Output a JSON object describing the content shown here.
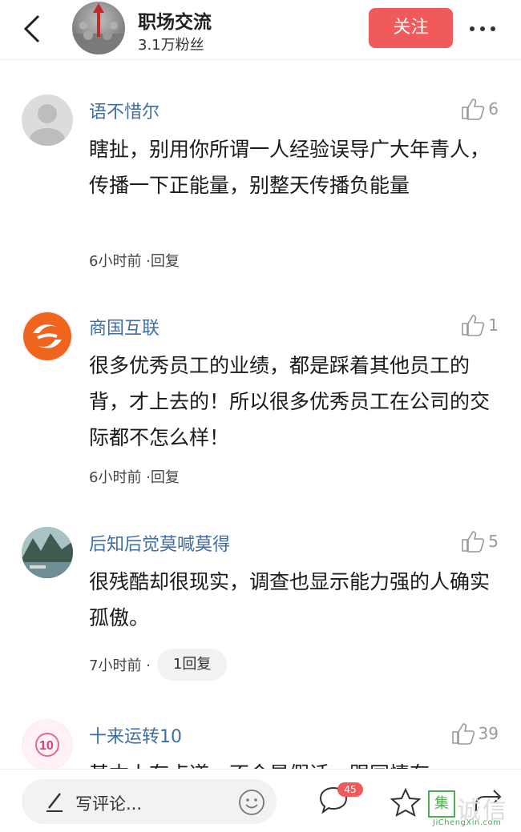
{
  "header": {
    "title": "职场交流",
    "fans": "3.1万粉丝",
    "follow_label": "关注"
  },
  "comments": [
    {
      "user": "语不惜尔",
      "likes": "6",
      "text": "瞎扯，别用你所谓一人经验误导广大年青人，传播一下正能量，别整天传播负能量",
      "time": "6小时前 · ",
      "reply": "回复"
    },
    {
      "user": "商国互联",
      "likes": "1",
      "text": "很多优秀员工的业绩，都是踩着其他员工的背，才上去的！所以很多优秀员工在公司的交际都不怎么样！",
      "time": "6小时前 · ",
      "reply": "回复"
    },
    {
      "user": "后知后觉莫喊莫得",
      "likes": "5",
      "text": "很残酷却很现实，调查也显示能力强的人确实孤傲。",
      "time": "7小时前 · ",
      "reply": "1回复"
    },
    {
      "user": "十来运转10",
      "likes": "39",
      "text": "基本上有点道，不会是假话，跟同情有",
      "time": "",
      "reply": ""
    }
  ],
  "bottom": {
    "write_placeholder": "写评论...",
    "comment_count": "45"
  },
  "watermark": {
    "logo_char": "集",
    "cn": "诚信",
    "en": "JiChengXin.com"
  },
  "colors": {
    "accent": "#f05a5a",
    "username": "#3d6ea5"
  }
}
